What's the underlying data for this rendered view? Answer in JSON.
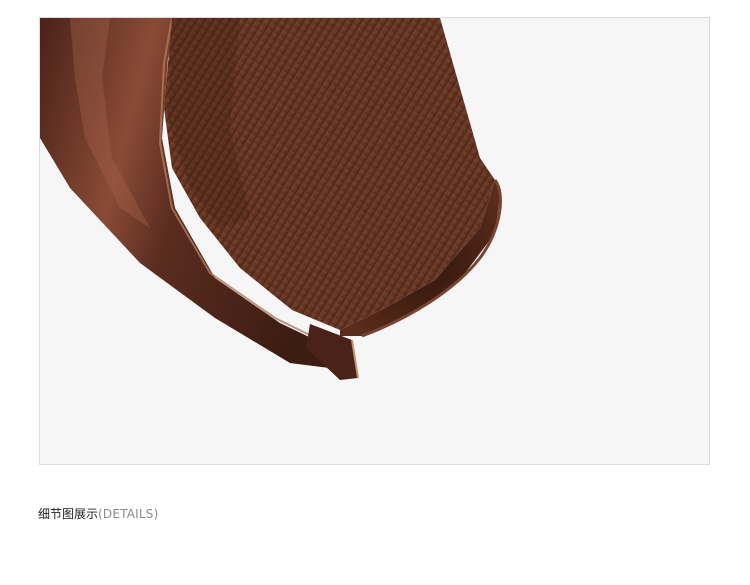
{
  "photo": {
    "subject": "leather-glove-knit-cuff",
    "colors": {
      "background": "#f6f6f6",
      "leather": "#5a2c20",
      "leather_highlight": "#9a5a44",
      "knit": "#6b3a26",
      "knit_rib_dark": "#4a2416",
      "knit_inner": "#3e1e12",
      "edge": "#b07a5c"
    }
  },
  "caption": {
    "main": "细节图展示",
    "sub": "(DETAILS)"
  }
}
